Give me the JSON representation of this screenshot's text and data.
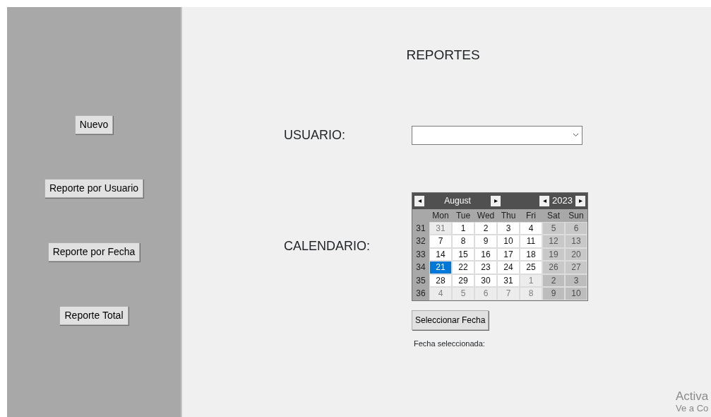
{
  "sidebar": {
    "buttons": [
      "Nuevo",
      "Reporte por Usuario",
      "Reporte por Fecha",
      "Reporte Total"
    ]
  },
  "title": "REPORTES",
  "user_field": {
    "label": "USUARIO:"
  },
  "calendar_field": {
    "label": "CALENDARIO:"
  },
  "calendar": {
    "month": "August",
    "year": "2023",
    "prev_month": "◂",
    "next_month": "▸",
    "prev_year": "◂",
    "next_year": "▸",
    "weekdays": [
      "Mon",
      "Tue",
      "Wed",
      "Thu",
      "Fri",
      "Sat",
      "Sun"
    ],
    "weeks": [
      {
        "week": "31",
        "days": [
          {
            "day": "31",
            "outside": true,
            "selected": false
          },
          {
            "day": "1",
            "outside": false,
            "selected": false
          },
          {
            "day": "2",
            "outside": false,
            "selected": false
          },
          {
            "day": "3",
            "outside": false,
            "selected": false
          },
          {
            "day": "4",
            "outside": false,
            "selected": false
          },
          {
            "day": "5",
            "outside": false,
            "selected": false
          },
          {
            "day": "6",
            "outside": false,
            "selected": false
          }
        ]
      },
      {
        "week": "32",
        "days": [
          {
            "day": "7",
            "outside": false,
            "selected": false
          },
          {
            "day": "8",
            "outside": false,
            "selected": false
          },
          {
            "day": "9",
            "outside": false,
            "selected": false
          },
          {
            "day": "10",
            "outside": false,
            "selected": false
          },
          {
            "day": "11",
            "outside": false,
            "selected": false
          },
          {
            "day": "12",
            "outside": false,
            "selected": false
          },
          {
            "day": "13",
            "outside": false,
            "selected": false
          }
        ]
      },
      {
        "week": "33",
        "days": [
          {
            "day": "14",
            "outside": false,
            "selected": false
          },
          {
            "day": "15",
            "outside": false,
            "selected": false
          },
          {
            "day": "16",
            "outside": false,
            "selected": false
          },
          {
            "day": "17",
            "outside": false,
            "selected": false
          },
          {
            "day": "18",
            "outside": false,
            "selected": false
          },
          {
            "day": "19",
            "outside": false,
            "selected": false
          },
          {
            "day": "20",
            "outside": false,
            "selected": false
          }
        ]
      },
      {
        "week": "34",
        "days": [
          {
            "day": "21",
            "outside": false,
            "selected": true
          },
          {
            "day": "22",
            "outside": false,
            "selected": false
          },
          {
            "day": "23",
            "outside": false,
            "selected": false
          },
          {
            "day": "24",
            "outside": false,
            "selected": false
          },
          {
            "day": "25",
            "outside": false,
            "selected": false
          },
          {
            "day": "26",
            "outside": false,
            "selected": false
          },
          {
            "day": "27",
            "outside": false,
            "selected": false
          }
        ]
      },
      {
        "week": "35",
        "days": [
          {
            "day": "28",
            "outside": false,
            "selected": false
          },
          {
            "day": "29",
            "outside": false,
            "selected": false
          },
          {
            "day": "30",
            "outside": false,
            "selected": false
          },
          {
            "day": "31",
            "outside": false,
            "selected": false
          },
          {
            "day": "1",
            "outside": true,
            "selected": false
          },
          {
            "day": "2",
            "outside": true,
            "selected": false
          },
          {
            "day": "3",
            "outside": true,
            "selected": false
          }
        ]
      },
      {
        "week": "36",
        "days": [
          {
            "day": "4",
            "outside": true,
            "selected": false
          },
          {
            "day": "5",
            "outside": true,
            "selected": false
          },
          {
            "day": "6",
            "outside": true,
            "selected": false
          },
          {
            "day": "7",
            "outside": true,
            "selected": false
          },
          {
            "day": "8",
            "outside": true,
            "selected": false
          },
          {
            "day": "9",
            "outside": true,
            "selected": false
          },
          {
            "day": "10",
            "outside": true,
            "selected": false
          }
        ]
      }
    ]
  },
  "select_button": "Seleccionar Fecha",
  "selected_date_label": "Fecha seleccionada:",
  "os_notice": [
    "Activa",
    "Ve a Co"
  ]
}
